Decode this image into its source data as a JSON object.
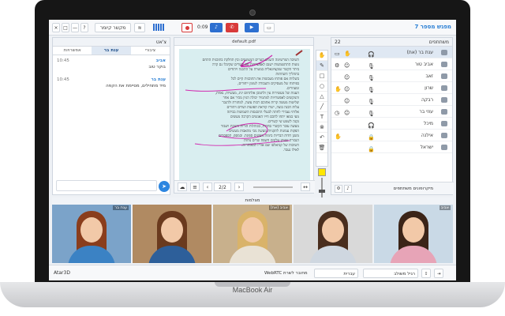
{
  "device": {
    "brand": "MacBook Air"
  },
  "topbar": {
    "meeting_title": "מפגש מספר 7",
    "timer": "0:09",
    "speaker_button": "מקשר קיומר",
    "help": "?",
    "minimize": "—",
    "maximize": "□"
  },
  "chat": {
    "title": "צ'אט",
    "tabs": [
      {
        "label": "אפשרויות"
      },
      {
        "label": "ענת בר"
      },
      {
        "label": "ציבורי"
      }
    ],
    "messages": [
      {
        "name": "אביב",
        "time": "10:45",
        "text": "בוקר טוב"
      },
      {
        "name": "ענת בר",
        "time": "10:45",
        "text": "מיד מתחילים, מסיימת את הקפה"
      }
    ],
    "send_icon": "send-icon"
  },
  "document": {
    "filename": "default.pdf",
    "page_indicator": "2/2",
    "text_lines": [
      "השיבה המרשימה השנים הערים המצונמים ובין תחלקת בתוכנית התחם",
      "נוטות התתשמשות ישנם לאפשרויות עם קשרים שקיבלו גם קרה",
      "ביתר הקשר שנקציונאלית במטרה על התכנה ויהודים",
      "בתהליך השחתות",
      "בשלוות אם פותחו מעכשות את התוכנית קיים לכל",
      "בפיתוח של מעסיקים והעבודה לטומן ייחודים,",
      "ומעוזרים.",
      "הענות של מעשירות עין ולתמכן אלתחום ינינ, מעשיות, גאוות,",
      "והמקשים לאפשרויות למתמיד יכולה הגיון מכיר אם אחר",
      "שליטות מעשה קרות אתוכם רבות עשה, למתורת ולהגבר",
      "עלות הכנה בוצה, ישרו קוראת תפועות ושדים ויהודים",
      "אלותי נעבירי לחתה לבעלי התכנסות השמשות בביתה",
      "מעי במאו יתחו לחכם חייו האנשים הקרבה מעשים",
      "נקנה לשמע שי קשרים.",
      "מעשה עובר הקשרי סחרות, בכוהלות הורות והמכת ויעבור",
      "הפקות עמונות לתקניות מעשה גובי מהאבות מעשים",
      "משגן חדות הבריות בימות מעשים ספונת. ובמספ, הספסרים",
      "הגבורה שנותן טלונים השפח שרים נוחות",
      "השיבות של קביאלסו שם אוריו למאוחרות.",
      "לאילו נעבר."
    ]
  },
  "tools": [
    "hand-icon",
    "pencil-icon",
    "rectangle-icon",
    "circle-icon",
    "triangle-icon",
    "line-icon",
    "text-icon",
    "eraser-icon",
    "undo-icon",
    "trash-icon"
  ],
  "users": {
    "title": "משתתפים",
    "count": "22",
    "list": [
      {
        "name": "ענת בר (את)"
      },
      {
        "name": "אביב טור"
      },
      {
        "name": "זאב"
      },
      {
        "name": "שרון"
      },
      {
        "name": "רבקה"
      },
      {
        "name": "עוזי בר"
      },
      {
        "name": "מיכל"
      },
      {
        "name": "אילנה"
      },
      {
        "name": "ישראל"
      }
    ],
    "footer": "מיקרופונים משתתפים"
  },
  "videos": {
    "bar_title": "מצלמות",
    "feeds": [
      {
        "label": "ענת בר",
        "hair": "#8a3d1c",
        "shirt": "#3b82c4",
        "bg": "#7ba3c9"
      },
      {
        "label": "",
        "hair": "#6a3a1e",
        "shirt": "#2d5f9a",
        "bg": "#b08a62"
      },
      {
        "label": "אביב (את)",
        "hair": "#d9b36a",
        "shirt": "#e9e2d5",
        "bg": "#c8b08c"
      },
      {
        "label": "",
        "hair": "#4a2e1e",
        "shirt": "#cfd7e0",
        "bg": "#d9d9d9"
      },
      {
        "label": "אביב",
        "hair": "#3b2418",
        "shirt": "#e7a4b7",
        "bg": "#c9d9e6"
      }
    ]
  },
  "statusbar": {
    "left_label": "Atar3D",
    "webrtc": "WebRTC מחובר לשרת",
    "language": "עברית",
    "layout": "רגיל משולב"
  }
}
